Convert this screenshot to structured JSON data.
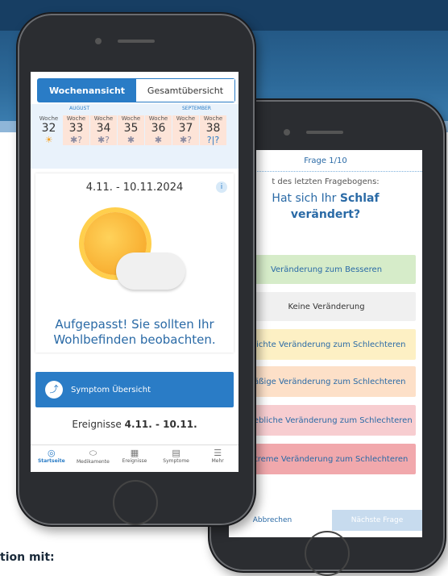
{
  "footer_text": "tion mit:",
  "phone1": {
    "segment": {
      "active": "Wochenansicht",
      "inactive": "Gesamtübersicht"
    },
    "months": [
      "AUGUST",
      "SEPTEMBER"
    ],
    "week_label": "Woche",
    "weeks": [
      {
        "num": "32",
        "icon": "☀"
      },
      {
        "num": "33",
        "icon": "✱?"
      },
      {
        "num": "34",
        "icon": "✱?"
      },
      {
        "num": "35",
        "icon": "✱"
      },
      {
        "num": "36",
        "icon": "✱"
      },
      {
        "num": "37",
        "icon": "✱?"
      },
      {
        "num": "38",
        "icon": "?|?"
      }
    ],
    "date_range": "4.11. - 10.11.2024",
    "info": "i",
    "message": "Aufgepasst! Sie sollten Ihr Wohlbefinden beobachten.",
    "symptom_button": "Symptom Übersicht",
    "events_prefix": "Ereignisse",
    "events_range": "4.11. - 10.11.",
    "tabs": [
      "Startseite",
      "Medikamente",
      "Ereignisse",
      "Symptome",
      "Mehr"
    ]
  },
  "phone2": {
    "question_header": "Frage 1/10",
    "question_prefix": "t des letzten Fragebogens:",
    "question_part1": "Hat sich Ihr ",
    "question_bold": "Schlaf",
    "question_part2": "verändert?",
    "answers": [
      "Veränderung zum Besseren",
      "Keine Veränderung",
      "Leichte Veränderung zum Schlechteren",
      "Mäßige Veränderung zum Schlechteren",
      "Erhebliche Veränderung zum Schlechteren",
      "Extreme Veränderung zum Schlechteren"
    ],
    "cancel": "Abbrechen",
    "next": "Nächste Frage"
  },
  "colors": {
    "accent": "#2a7cc6",
    "banner": "#1f4f7a"
  }
}
